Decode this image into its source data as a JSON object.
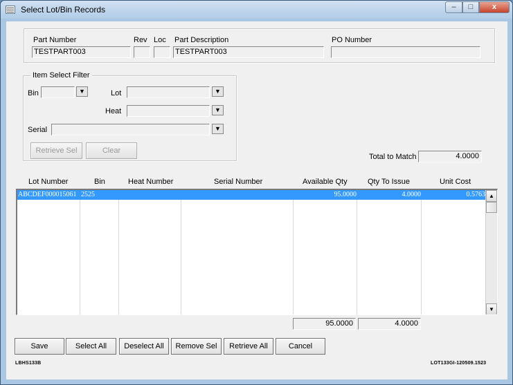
{
  "window": {
    "title": "Select Lot/Bin Records",
    "min": "‒",
    "max": "□",
    "close": "x"
  },
  "header": {
    "part_number_label": "Part Number",
    "rev_label": "Rev",
    "loc_label": "Loc",
    "part_description_label": "Part Description",
    "po_number_label": "PO Number",
    "part_number": "TESTPART003",
    "rev": "",
    "loc": "",
    "part_description": "TESTPART003",
    "po_number": ""
  },
  "filter": {
    "group_label": "Item Select Filter",
    "bin_label": "Bin",
    "lot_label": "Lot",
    "heat_label": "Heat",
    "serial_label": "Serial",
    "bin": "",
    "lot": "",
    "heat": "",
    "serial": "",
    "retrieve_sel": "Retrieve Sel",
    "clear": "Clear"
  },
  "total": {
    "label": "Total to Match",
    "value": "4.0000"
  },
  "grid": {
    "columns": [
      "Lot Number",
      "Bin",
      "Heat Number",
      "Serial Number",
      "Available Qty",
      "Qty To Issue",
      "Unit Cost"
    ],
    "rows": [
      {
        "lot_number": "ABCDEF000015061",
        "bin": "2525",
        "heat_number": "",
        "serial_number": "",
        "available_qty": "95.0000",
        "qty_to_issue": "4.0000",
        "unit_cost": "0.5763"
      }
    ],
    "totals": {
      "available_qty": "95.0000",
      "qty_to_issue": "4.0000"
    }
  },
  "buttons": {
    "save": "Save",
    "select_all": "Select All",
    "deselect_all": "Deselect All",
    "remove_sel": "Remove Sel",
    "retrieve_all": "Retrieve All",
    "cancel": "Cancel"
  },
  "footer": {
    "left_code": "LBHS133B",
    "right_code": "LOT133GI-120509.1523"
  },
  "colors": {
    "selection": "#3399ff",
    "title_bar": "#b2cde8",
    "close_button": "#c7432a"
  }
}
